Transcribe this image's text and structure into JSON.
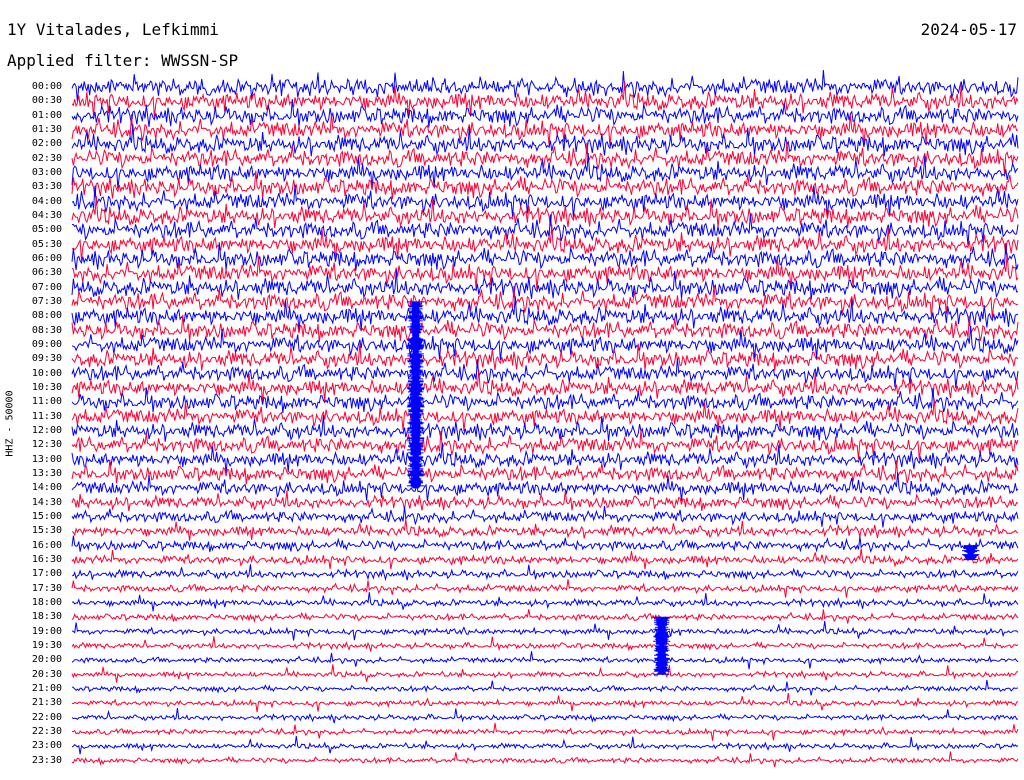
{
  "header": {
    "station": "1Y Vitalades, Lefkimmi",
    "date": "2024-05-17",
    "filter": "Applied filter: WWSSN-SP"
  },
  "colors": {
    "line_a": "#0000ff",
    "line_b": "#ff0033",
    "background": "#ffffff"
  },
  "chart_data": {
    "type": "line",
    "title": "1Y Vitalades, Lefkimmi",
    "date": "2024-05-17",
    "filter": "Applied filter: WWSSN-SP",
    "ylabel": "HHZ - 50000",
    "x_unit": "minutes",
    "xlim": [
      0,
      30
    ],
    "row_tick_labels": [
      "00:00",
      "00:30",
      "01:00",
      "01:30",
      "02:00",
      "02:30",
      "03:00",
      "03:30",
      "04:00",
      "04:30",
      "05:00",
      "05:30",
      "06:00",
      "06:30",
      "07:00",
      "07:30",
      "08:00",
      "08:30",
      "09:00",
      "09:30",
      "10:00",
      "10:30",
      "11:00",
      "11:30",
      "12:00",
      "12:30",
      "13:00",
      "13:30",
      "14:00",
      "14:30",
      "15:00",
      "15:30",
      "16:00",
      "16:30",
      "17:00",
      "17:30",
      "18:00",
      "18:30",
      "19:00",
      "19:30",
      "20:00",
      "20:30",
      "21:00",
      "21:30",
      "22:00",
      "22:30",
      "23:00",
      "23:30"
    ],
    "series": [
      {
        "color": "#0000ff",
        "rows": "even"
      },
      {
        "color": "#ff0033",
        "rows": "odd"
      }
    ],
    "noise_level_by_row": [
      1.0,
      1.0,
      1.0,
      1.0,
      1.0,
      1.0,
      1.0,
      1.0,
      1.0,
      1.0,
      1.0,
      1.0,
      1.0,
      1.0,
      1.0,
      1.0,
      1.0,
      0.95,
      0.95,
      0.95,
      0.9,
      0.9,
      0.9,
      0.9,
      0.9,
      0.9,
      0.85,
      0.85,
      0.8,
      0.7,
      0.65,
      0.6,
      0.55,
      0.5,
      0.45,
      0.4,
      0.38,
      0.36,
      0.34,
      0.32,
      0.3,
      0.3,
      0.3,
      0.3,
      0.3,
      0.3,
      0.3,
      0.3
    ],
    "events": [
      {
        "row_start": "07:30",
        "row_end": "14:00",
        "minute": 10.9,
        "label": ""
      },
      {
        "row_start": "18:30",
        "row_end": "20:30",
        "minute": 18.7,
        "label": ""
      },
      {
        "row_start": "16:00",
        "row_end": "16:30",
        "minute": 28.5,
        "label": ""
      }
    ]
  }
}
